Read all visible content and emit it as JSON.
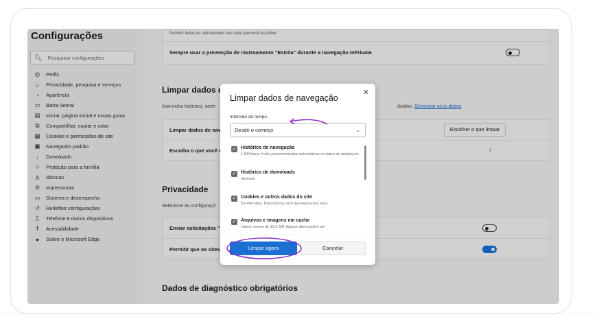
{
  "sidebar": {
    "title": "Configurações",
    "search_placeholder": "Pesquisar configurações",
    "items": [
      {
        "label": "Perfis",
        "icon": "profile-icon"
      },
      {
        "label": "Privacidade, pesquisa e serviços",
        "icon": "lock-icon"
      },
      {
        "label": "Aparência",
        "icon": "appearance-icon"
      },
      {
        "label": "Barra lateral",
        "icon": "sidebar-icon"
      },
      {
        "label": "Iniciar, página inicial e novas guias",
        "icon": "home-icon"
      },
      {
        "label": "Compartilhar, copiar e colar",
        "icon": "share-icon"
      },
      {
        "label": "Cookies e permissões de site",
        "icon": "cookie-icon"
      },
      {
        "label": "Navegador padrão",
        "icon": "browser-icon"
      },
      {
        "label": "Downloads",
        "icon": "download-icon"
      },
      {
        "label": "Proteção para a família",
        "icon": "family-icon"
      },
      {
        "label": "Idiomas",
        "icon": "language-icon"
      },
      {
        "label": "Impressoras",
        "icon": "printer-icon"
      },
      {
        "label": "Sistema e desempenho",
        "icon": "system-icon"
      },
      {
        "label": "Redefinir configurações",
        "icon": "reset-icon"
      },
      {
        "label": "Telefone e outros dispositivos",
        "icon": "phone-icon"
      },
      {
        "label": "Acessibilidade",
        "icon": "accessibility-icon"
      },
      {
        "label": "Sobre o Microsoft Edge",
        "icon": "edge-icon"
      }
    ]
  },
  "main": {
    "trackers_note": "Permitir todos os rastreadores nos sites que você escolher",
    "strict_row": "Sempre usar a prevenção de rastreamento \"Estrita\" durante a navegação InPrivate",
    "clear_heading": "Limpar dados de",
    "clear_desc": "Isso inclui histórico, senh",
    "clear_desc_tail": "cluídos.",
    "manage_link": "Gerenciar seus dados",
    "clear_now_row": "Limpar dados de nave",
    "choose_button": "Escolher o que limpar",
    "choose_row": "Escolha o que você q",
    "privacy_heading": "Privacidade",
    "privacy_desc": "Selecione as configuraçõ",
    "send_requests_row": "Enviar solicitações \"N",
    "allow_sites_row": "Permitir que os sites",
    "diagnostics_heading": "Dados de diagnóstico obrigatórios"
  },
  "dialog": {
    "title": "Limpar dados de navegação",
    "range_label": "Intervalo de tempo",
    "range_value": "Desde o começo",
    "options": [
      {
        "title": "Histórico de navegação",
        "desc": "1.694 itens. Inclui preenchimentos automáticos na barra de endereços.",
        "checked": true
      },
      {
        "title": "Histórico de downloads",
        "desc": "Nenhum",
        "checked": true
      },
      {
        "title": "Cookies e outros dados do site",
        "desc": "De 404 sites. Desconecta você da maioria dos sites.",
        "checked": true
      },
      {
        "title": "Arquivos e imagens em cache",
        "desc": "Libera menos de 31,3 MB. Alguns sites podem ser",
        "checked": true
      }
    ],
    "primary_button": "Limpar agora",
    "secondary_button": "Cancelar",
    "accent_color": "#1a6fd1",
    "annotation_color": "#8b2fc9"
  }
}
